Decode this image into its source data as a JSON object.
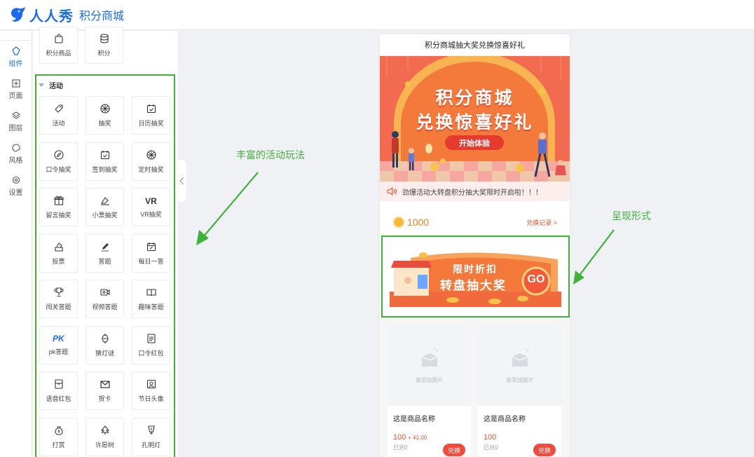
{
  "header": {
    "brand": "人人秀",
    "subtitle": "积分商城"
  },
  "rail": [
    {
      "label": "组件",
      "icon": "component-icon",
      "active": true
    },
    {
      "label": "页面",
      "icon": "page-icon"
    },
    {
      "label": "图层",
      "icon": "layers-icon"
    },
    {
      "label": "风格",
      "icon": "palette-icon"
    },
    {
      "label": "设置",
      "icon": "settings-icon"
    }
  ],
  "panel": {
    "top_items": [
      {
        "label": "积分商品",
        "icon": "shopping-bag-icon"
      },
      {
        "label": "积分",
        "icon": "coins-icon"
      }
    ],
    "section_title": "活动",
    "activity_items": [
      {
        "label": "活动",
        "icon": "tag-icon"
      },
      {
        "label": "抽奖",
        "icon": "wheel-icon"
      },
      {
        "label": "日历抽奖",
        "icon": "calendar-check-icon"
      },
      {
        "label": "口令抽奖",
        "icon": "compass-icon"
      },
      {
        "label": "签到抽奖",
        "icon": "calendar-check-icon"
      },
      {
        "label": "定时抽奖",
        "icon": "wheel-icon"
      },
      {
        "label": "留言抽奖",
        "icon": "gift-box-icon"
      },
      {
        "label": "小票抽奖",
        "icon": "receipt-icon"
      },
      {
        "label": "VR抽奖",
        "icon": "vr-icon",
        "glyph": "VR"
      },
      {
        "label": "投票",
        "icon": "vote-icon"
      },
      {
        "label": "答题",
        "icon": "pencil-icon"
      },
      {
        "label": "每日一答",
        "icon": "calendar-edit-icon"
      },
      {
        "label": "闯关答题",
        "icon": "trophy-icon"
      },
      {
        "label": "视频答题",
        "icon": "video-icon"
      },
      {
        "label": "趣味答题",
        "icon": "book-icon"
      },
      {
        "label": "pk答题",
        "icon": "pk-icon",
        "glyph": "PK"
      },
      {
        "label": "猜灯谜",
        "icon": "lantern-icon"
      },
      {
        "label": "口令红包",
        "icon": "red-packet-icon"
      },
      {
        "label": "语音红包",
        "icon": "voice-packet-icon"
      },
      {
        "label": "贺卡",
        "icon": "envelope-icon"
      },
      {
        "label": "节日头像",
        "icon": "portrait-icon"
      },
      {
        "label": "打赏",
        "icon": "money-bag-icon"
      },
      {
        "label": "许愿树",
        "icon": "tree-icon"
      },
      {
        "label": "孔明灯",
        "icon": "sky-lantern-icon"
      }
    ]
  },
  "annotations": {
    "left": "丰富的活动玩法",
    "right": "呈现形式"
  },
  "phone": {
    "title": "积分商城抽大奖兑换惊喜好礼",
    "banner": {
      "line1": "积分商城",
      "line2": "兑换惊喜好礼",
      "button": "开始体验"
    },
    "notice": "劲爆活动大转盘积分抽大奖限时开启啦！！！",
    "points": "1000",
    "record_link": "兑换记录 >",
    "promo": {
      "line1": "限时折扣",
      "line2": "转盘抽大奖",
      "go": "GO"
    },
    "cards": [
      {
        "placeholder": "请添加图片",
        "name": "这是商品名称",
        "price": "100",
        "price_extra": "+ ¥1.00",
        "sold": "已兑0",
        "button": "兑换"
      },
      {
        "placeholder": "请添加图片",
        "name": "这是商品名称",
        "price": "100",
        "price_extra": "",
        "sold": "已兑0",
        "button": "兑换"
      }
    ]
  },
  "colors": {
    "brand": "#1a6bf0",
    "highlight": "#3fb23a",
    "accent": "#f04b3c",
    "points": "#f07b1e"
  }
}
